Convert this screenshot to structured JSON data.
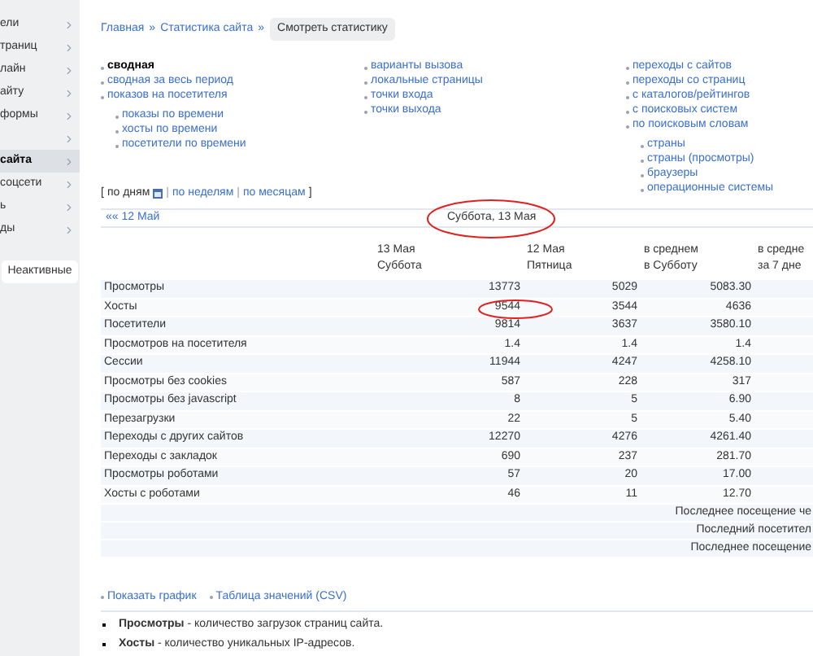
{
  "sidebar": {
    "items": [
      {
        "label": "ели",
        "selected": false
      },
      {
        "label": "траниц",
        "selected": false
      },
      {
        "label": "лайн",
        "selected": false
      },
      {
        "label": "айту",
        "selected": false
      },
      {
        "label": "формы",
        "selected": false
      },
      {
        "selected": false
      },
      {
        "label": "сайта",
        "selected": true
      },
      {
        "label": "соцсети",
        "selected": false
      },
      {
        "label": "ь",
        "selected": false
      },
      {
        "label": "ды",
        "selected": false
      }
    ],
    "button": "Неактивные"
  },
  "breadcrumb": {
    "links": [
      "Главная",
      "Статистика сайта"
    ],
    "separator": "»",
    "button": "Смотреть статистику"
  },
  "report_menu": {
    "columns": [
      [
        {
          "label": "сводная",
          "selected": true
        },
        {
          "label": "сводная за весь период",
          "selected": false
        },
        {
          "label": "показов на посетителя",
          "selected": false,
          "children": [
            {
              "label": "показы по времени",
              "selected": false
            },
            {
              "label": "хосты по времени",
              "selected": false
            },
            {
              "label": "посетители по времени",
              "selected": false
            }
          ]
        }
      ],
      [
        {
          "label": "варианты вызова",
          "selected": false
        },
        {
          "label": "локальные страницы",
          "selected": false
        },
        {
          "label": "точки входа",
          "selected": false
        },
        {
          "label": "точки выхода",
          "selected": false
        }
      ],
      [
        {
          "label": "переходы с сайтов",
          "selected": false
        },
        {
          "label": "переходы со страниц",
          "selected": false
        },
        {
          "label": "с каталогов/рейтингов",
          "selected": false
        },
        {
          "label": "с поисковых систем",
          "selected": false
        },
        {
          "label": "по поисковым словам",
          "selected": false,
          "children": [
            {
              "label": "страны",
              "selected": false
            },
            {
              "label": "страны (просмотры)",
              "selected": false
            },
            {
              "label": "браузеры",
              "selected": false
            },
            {
              "label": "операционные системы",
              "selected": false
            }
          ]
        }
      ]
    ]
  },
  "period_switch": {
    "open": "[",
    "close": "]",
    "divider": "|",
    "items": [
      {
        "label": "по дням",
        "selected": true
      },
      {
        "label": "по неделям",
        "selected": false
      },
      {
        "label": "по месяцам",
        "selected": false
      }
    ]
  },
  "date_nav": {
    "previous": "«« 12 Май",
    "current": "Суббота, 13 Мая"
  },
  "table": {
    "columns": [
      [
        "13 Мая",
        "Суббота"
      ],
      [
        "12 Мая",
        "Пятница"
      ],
      [
        "в среднем",
        "в Субботу"
      ],
      [
        "в средне",
        "за 7 дне"
      ]
    ],
    "rows": [
      {
        "label": "Просмотры",
        "values": [
          "13773",
          "5029",
          "5083.30"
        ]
      },
      {
        "label": "Хосты",
        "values": [
          "9544",
          "3544",
          "4636"
        ]
      },
      {
        "label": "Посетители",
        "values": [
          "9814",
          "3637",
          "3580.10"
        ]
      },
      {
        "label": "Просмотров на посетителя",
        "values": [
          "1.4",
          "1.4",
          "1.4"
        ]
      },
      {
        "label": "Сессии",
        "values": [
          "11944",
          "4247",
          "4258.10"
        ]
      },
      {
        "label": "Просмотры без cookies",
        "values": [
          "587",
          "228",
          "317"
        ]
      },
      {
        "label": "Просмотры без javascript",
        "values": [
          "8",
          "5",
          "6.90"
        ]
      },
      {
        "label": "Перезагрузки",
        "values": [
          "22",
          "5",
          "5.40"
        ]
      },
      {
        "label": "Переходы с других сайтов",
        "values": [
          "12270",
          "4276",
          "4261.40"
        ]
      },
      {
        "label": "Переходы с закладок",
        "values": [
          "690",
          "237",
          "281.70"
        ]
      },
      {
        "label": "Просмотры роботами",
        "values": [
          "57",
          "20",
          "17.00"
        ]
      },
      {
        "label": "Хосты с роботами",
        "values": [
          "46",
          "11",
          "12.70"
        ]
      }
    ],
    "footer_rows": [
      "Последнее посещение че",
      "Последний посетител",
      "Последнее посещение"
    ]
  },
  "links": [
    "Показать график",
    "Таблица значений (CSV)"
  ],
  "legend": [
    "**Просмотры** - количество загрузок страниц сайта.",
    "**Хосты** - количество уникальных IP-адресов."
  ]
}
